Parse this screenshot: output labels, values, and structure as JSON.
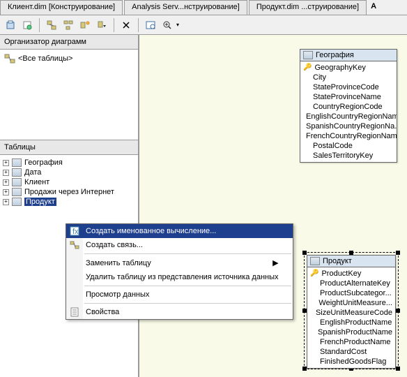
{
  "tabs": [
    {
      "label": "Клиент.dim [Конструирование]"
    },
    {
      "label": "Analysis Serv...нструирование]"
    },
    {
      "label": "Продукт.dim ...струирование]"
    }
  ],
  "tab_extra": "A",
  "organizer": {
    "title": "Организатор диаграмм",
    "all_tables": "<Все таблицы>"
  },
  "tables": {
    "title": "Таблицы",
    "items": [
      {
        "label": "География"
      },
      {
        "label": "Дата"
      },
      {
        "label": "Клиент"
      },
      {
        "label": "Продажи через Интернет"
      },
      {
        "label": "Продукт"
      }
    ]
  },
  "entity_geo": {
    "title": "География",
    "cols": [
      "GeographyKey",
      "City",
      "StateProvinceCode",
      "StateProvinceName",
      "CountryRegionCode",
      "EnglishCountryRegionName",
      "SpanishCountryRegionNa...",
      "FrenchCountryRegionName",
      "PostalCode",
      "SalesTerritoryKey"
    ]
  },
  "entity_prod": {
    "title": "Продукт",
    "cols": [
      "ProductKey",
      "ProductAlternateKey",
      "ProductSubcategor...",
      "WeightUnitMeasure...",
      "SizeUnitMeasureCode",
      "EnglishProductName",
      "SpanishProductName",
      "FrenchProductName",
      "StandardCost",
      "FinishedGoodsFlag"
    ]
  },
  "menu": {
    "items": [
      {
        "label": "Создать именованное вычисление...",
        "hl": true
      },
      {
        "label": "Создать связь..."
      },
      {
        "label": "Заменить таблицу",
        "sub": true
      },
      {
        "label": "Удалить таблицу из представления источника данных"
      },
      {
        "label": "Просмотр данных"
      },
      {
        "label": "Свойства"
      }
    ]
  }
}
